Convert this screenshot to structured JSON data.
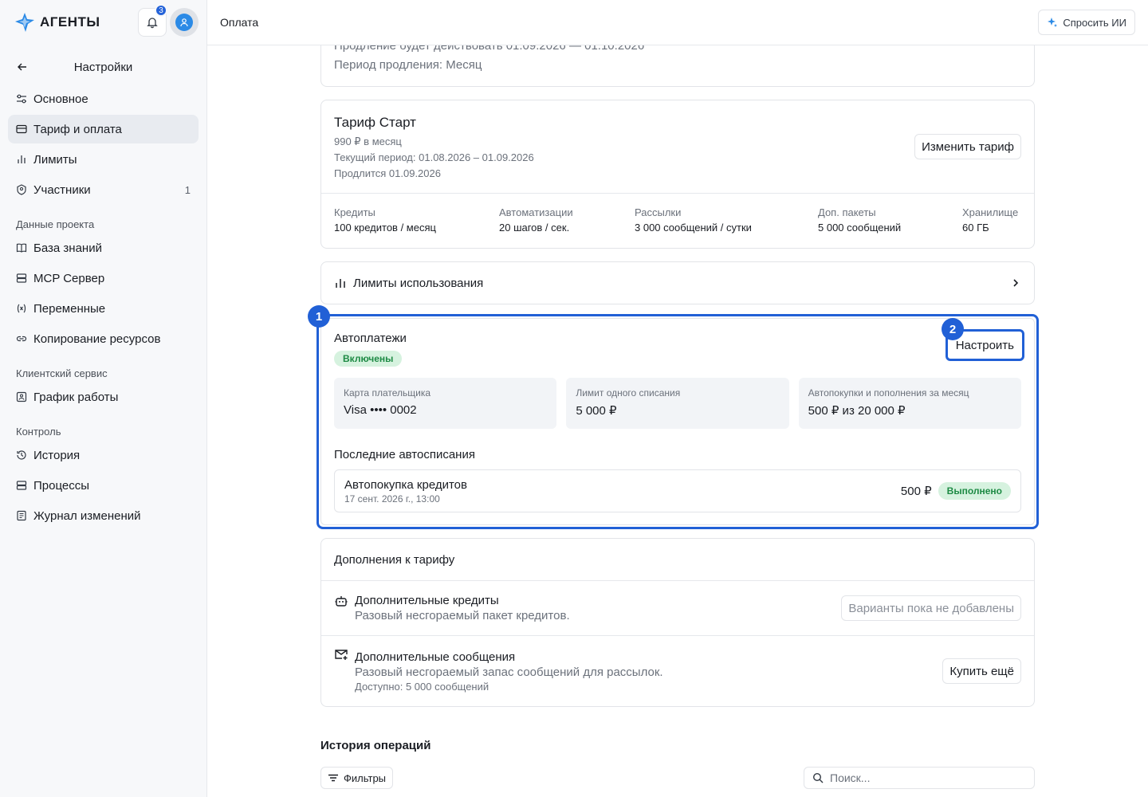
{
  "app": {
    "name": "АГЕНТЫ",
    "notifications_count": "3"
  },
  "header": {
    "title": "Оплата",
    "ask_ai_label": "Спросить ИИ"
  },
  "sidebar": {
    "back_title": "Настройки",
    "items_main": [
      {
        "label": "Основное",
        "icon": "sliders-icon"
      },
      {
        "label": "Тариф и оплата",
        "icon": "card-icon",
        "active": true
      },
      {
        "label": "Лимиты",
        "icon": "bar-chart-icon"
      },
      {
        "label": "Участники",
        "icon": "users-icon",
        "count": "1"
      }
    ],
    "section_project": "Данные проекта",
    "items_project": [
      {
        "label": "База знаний",
        "icon": "book-icon"
      },
      {
        "label": "MCP Сервер",
        "icon": "server-icon"
      },
      {
        "label": "Переменные",
        "icon": "variable-icon"
      },
      {
        "label": "Копирование ресурсов",
        "icon": "link-icon"
      }
    ],
    "section_client": "Клиентский сервис",
    "items_client": [
      {
        "label": "График работы",
        "icon": "calendar-icon"
      }
    ],
    "section_control": "Контроль",
    "items_control": [
      {
        "label": "История",
        "icon": "history-icon"
      },
      {
        "label": "Процессы",
        "icon": "stack-icon"
      },
      {
        "label": "Журнал изменений",
        "icon": "log-icon"
      }
    ]
  },
  "renewal": {
    "line1": "Продление будет действовать 01.09.2026 — 01.10.2026",
    "line2": "Период продления: Месяц"
  },
  "plan": {
    "name": "Тариф Старт",
    "price": "990 ₽ в месяц",
    "period": "Текущий период: 01.08.2026 – 01.09.2026",
    "renews": "Продлится 01.09.2026",
    "change_label": "Изменить тариф",
    "stats": [
      {
        "label": "Кредиты",
        "value": "100 кредитов / месяц"
      },
      {
        "label": "Автоматизации",
        "value": "20 шагов / сек."
      },
      {
        "label": "Рассылки",
        "value": "3 000 сообщений / сутки"
      },
      {
        "label": "Доп. пакеты",
        "value": "5 000 сообщений"
      },
      {
        "label": "Хранилище",
        "value": "60 ГБ"
      }
    ]
  },
  "limits": {
    "label": "Лимиты использования"
  },
  "autopay": {
    "title": "Автоплатежи",
    "status": "Включены",
    "configure_label": "Настроить",
    "badge_1": "1",
    "badge_2": "2",
    "card_label": "Карта плательщика",
    "card_value": "Visa •••• 0002",
    "limit_label": "Лимит одного списания",
    "limit_value": "5 000 ₽",
    "monthly_label": "Автопокупки и пополнения за месяц",
    "monthly_value": "500 ₽ из 20 000 ₽",
    "recent_title": "Последние автосписания",
    "recent": [
      {
        "name": "Автопокупка кредитов",
        "date": "17 сент. 2026 г., 13:00",
        "amount": "500 ₽",
        "status": "Выполнено"
      }
    ]
  },
  "addons": {
    "title": "Дополнения к тарифу",
    "items": [
      {
        "name": "Дополнительные кредиты",
        "desc": "Разовый несгораемый пакет кредитов.",
        "action": "Варианты пока не добавлены"
      },
      {
        "name": "Дополнительные сообщения",
        "desc": "Разовый несгораемый запас сообщений для рассылок.",
        "extra": "Доступно: 5 000 сообщений",
        "action": "Купить ещё"
      }
    ]
  },
  "history": {
    "title": "История операций",
    "filters_label": "Фильтры",
    "search_placeholder": "Поиск..."
  },
  "colors": {
    "accent": "#2160d6",
    "success_bg": "#d6f2df",
    "success_text": "#1d8a44"
  }
}
